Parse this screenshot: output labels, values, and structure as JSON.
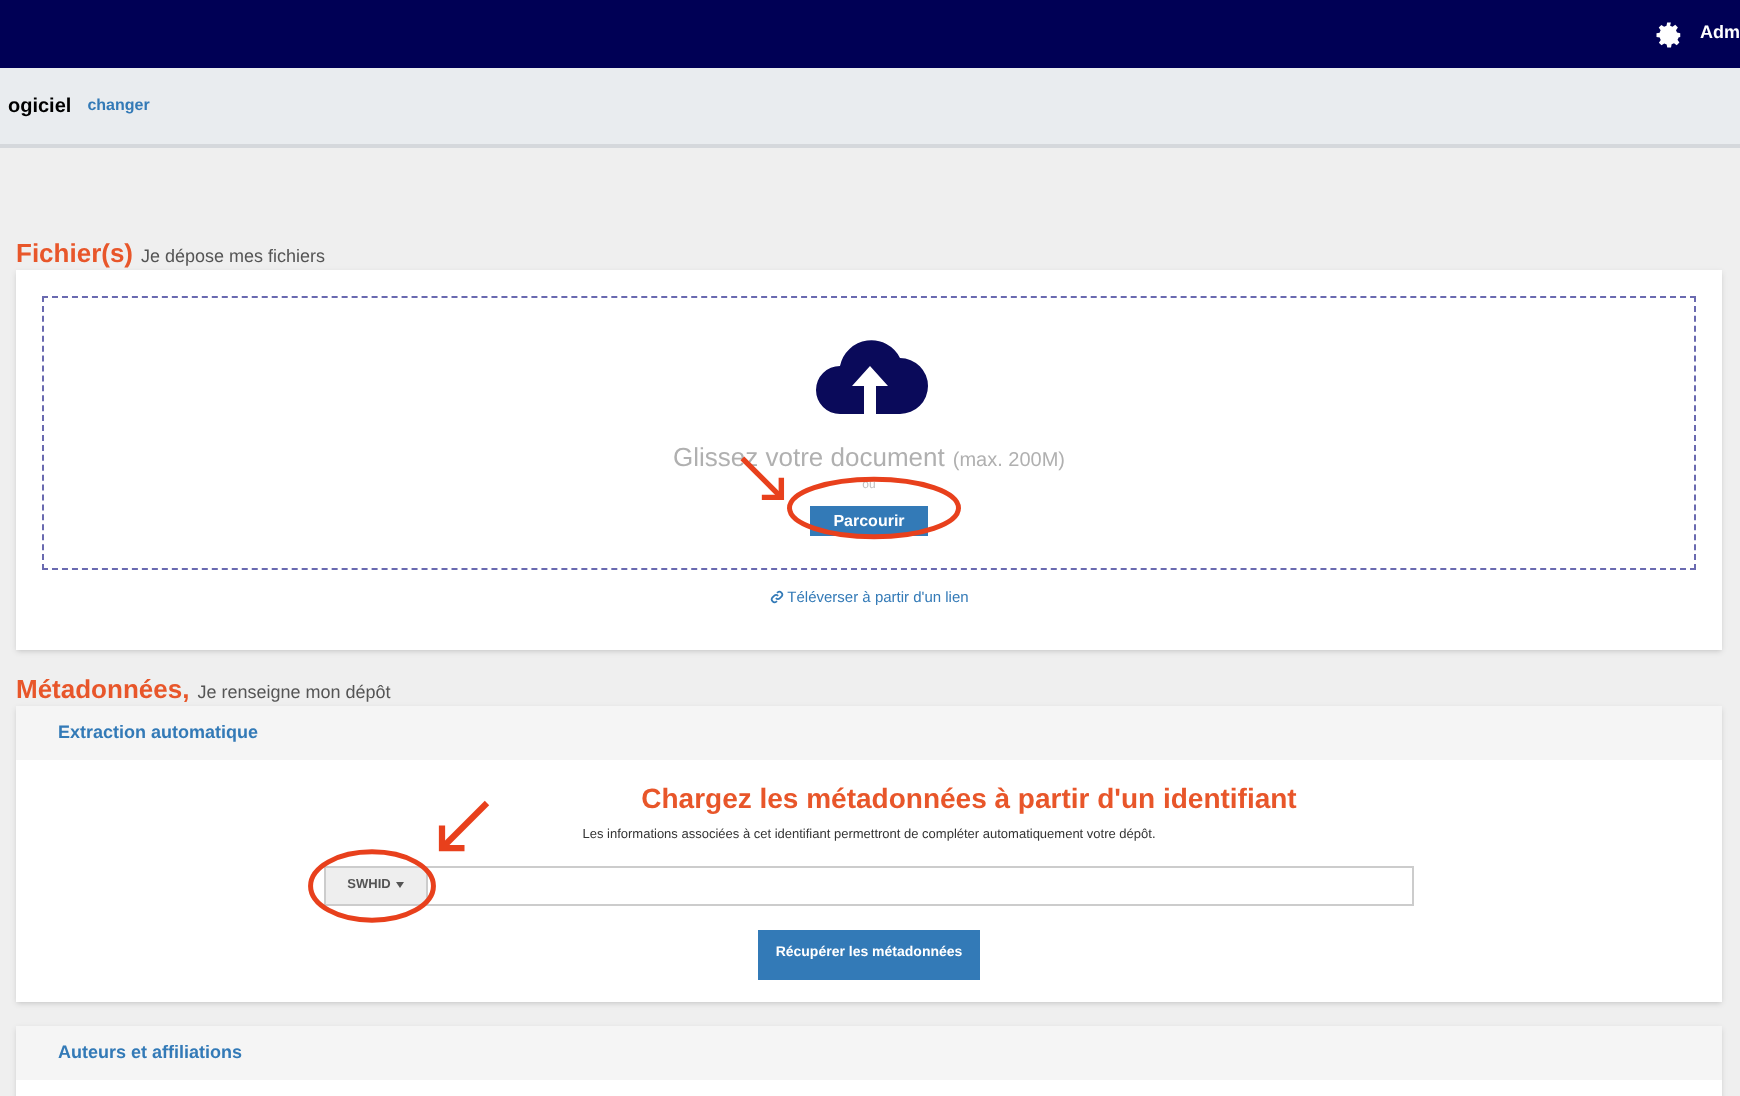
{
  "top_bar": {
    "user_label": "Adm"
  },
  "sub_header": {
    "type_label": "ogiciel",
    "change_link": "changer"
  },
  "files_section": {
    "title": "Fichier(s)",
    "subtitle": "Je dépose mes fichiers",
    "drop_text": "Glissez votre document",
    "max_size": "(max. 200M)",
    "or_text": "ou",
    "browse_button": "Parcourir",
    "link_upload": "Téléverser à partir d'un lien"
  },
  "metadata_section": {
    "title": "Métadonnées,",
    "subtitle": "Je renseigne mon dépôt",
    "panels": [
      {
        "title": "Extraction automatique",
        "heading": "Chargez les métadonnées à partir d'un identifiant",
        "help": "Les informations associées à cet identifiant permettront de compléter automatiquement votre dépôt.",
        "identifier_type": "SWHID",
        "submit_button": "Récupérer les métadonnées"
      },
      {
        "title": "Auteurs et affiliations"
      }
    ]
  }
}
